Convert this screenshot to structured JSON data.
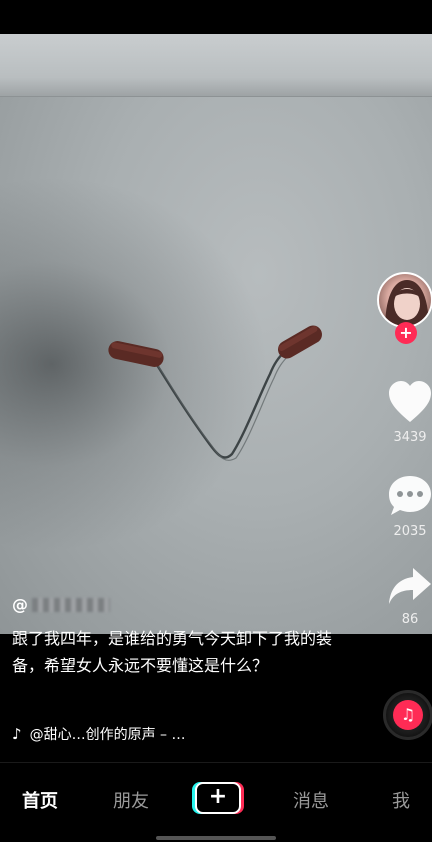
{
  "video": {
    "author_handle_prefix": "@",
    "caption": "跟了我四年，是谁给的勇气今天卸下了我的装备，希望女人永远不要懂这是什么？",
    "music": "@甜心…创作的原声 – …"
  },
  "sidebar": {
    "like_count": "3439",
    "comment_count": "2035",
    "share_count": "86",
    "follow_symbol": "+"
  },
  "bottom_nav": {
    "items": [
      "首页",
      "朋友",
      "+",
      "消息",
      "我"
    ]
  },
  "colors": {
    "accent": "#fe2c55",
    "secondary": "#25f4ee"
  },
  "icons": [
    "heart-icon",
    "comment-icon",
    "share-icon",
    "music-note-icon",
    "music-disc-icon"
  ]
}
